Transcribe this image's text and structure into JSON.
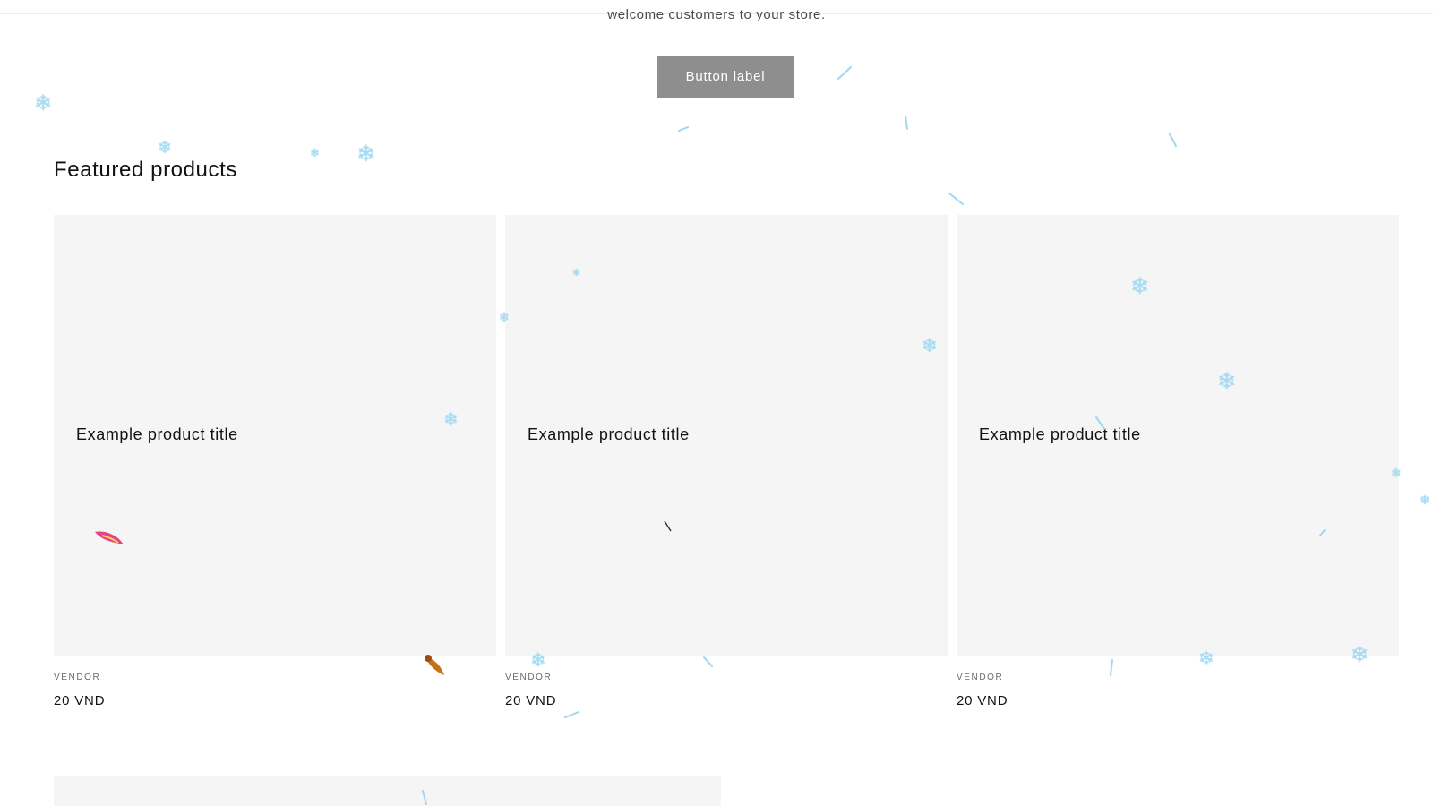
{
  "banner": {
    "welcome_text": "welcome customers to your store.",
    "button_label": "Button label"
  },
  "featured": {
    "title": "Featured products",
    "products": [
      {
        "title": "Example product title",
        "vendor": "VENDOR",
        "price": "20 VND"
      },
      {
        "title": "Example product title",
        "vendor": "VENDOR",
        "price": "20 VND"
      },
      {
        "title": "Example product title",
        "vendor": "VENDOR",
        "price": "20 VND"
      }
    ]
  },
  "decorations": {
    "flake_icon": "snowflake-icon",
    "flake_color": "#a8dcf3",
    "leaf_colors": [
      "#e8408a",
      "#c8701a"
    ]
  },
  "colors": {
    "button_bg": "#8e8e8e",
    "card_bg": "#f5f5f5",
    "text": "#121212"
  }
}
